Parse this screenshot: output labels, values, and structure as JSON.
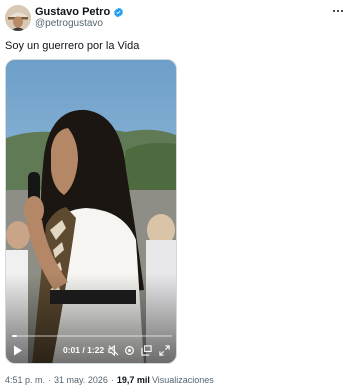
{
  "author": {
    "display_name": "Gustavo Petro",
    "handle": "@petrogustavo",
    "verified": true,
    "avatar_icon": "avatar-portrait",
    "verified_color": "#1d9bf0"
  },
  "tweet": {
    "text": "Soy un guerrero por la Vida"
  },
  "video": {
    "current_time": "0:01",
    "duration": "1:22",
    "progress_fraction": 0.0122,
    "controls": [
      "play-icon",
      "mute-icon",
      "settings-icon",
      "pip-icon",
      "fullscreen-icon"
    ]
  },
  "meta": {
    "time": "4:51 p. m.",
    "separator": "·",
    "date": "31 may. 2026",
    "views_count": "19,7 mil",
    "views_label": "Visualizaciones"
  },
  "colors": {
    "text_primary": "#0f1419",
    "text_secondary": "#536471",
    "accent": "#1d9bf0"
  }
}
